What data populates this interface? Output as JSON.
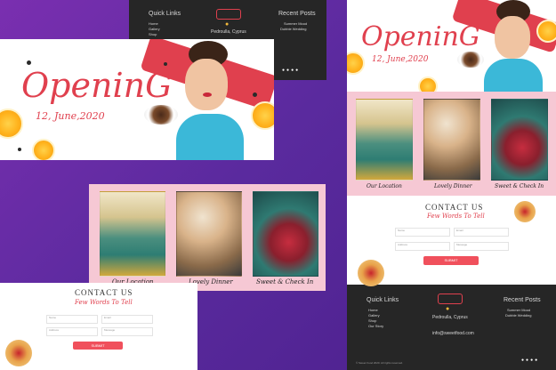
{
  "hero": {
    "title": "OpeninG",
    "date": "12, June,2020"
  },
  "sections": {
    "captions": [
      "Our Location",
      "Lovely Dinner",
      "Sweet & Check In"
    ],
    "contact_title": "CONTACT US",
    "contact_subtitle": "Few Words To Tell",
    "fields": {
      "name": "Name",
      "email": "Email",
      "address": "Address",
      "message": "Message"
    },
    "submit": "SUBMIT"
  },
  "footer": {
    "quick_links_title": "Quick Links",
    "quick_links": [
      "Home",
      "Gallery",
      "Shop",
      "Our Story"
    ],
    "address": "Pedroulla, Cyprus",
    "email": "info@sweetfood.com",
    "recent_posts_title": "Recent Posts",
    "recent_posts": [
      "Summer Mood",
      "Dubble Wedding"
    ],
    "copyright": "© Sweet Food 2020. All rights reserved."
  },
  "colors": {
    "background_purple": "#6b2aa5",
    "accent_red": "#e0404e",
    "section_pink": "#f6c8d4",
    "footer_dark": "#262626"
  },
  "icons": [
    "location-icon",
    "facebook-icon",
    "twitter-icon",
    "instagram-icon",
    "pinterest-icon"
  ]
}
